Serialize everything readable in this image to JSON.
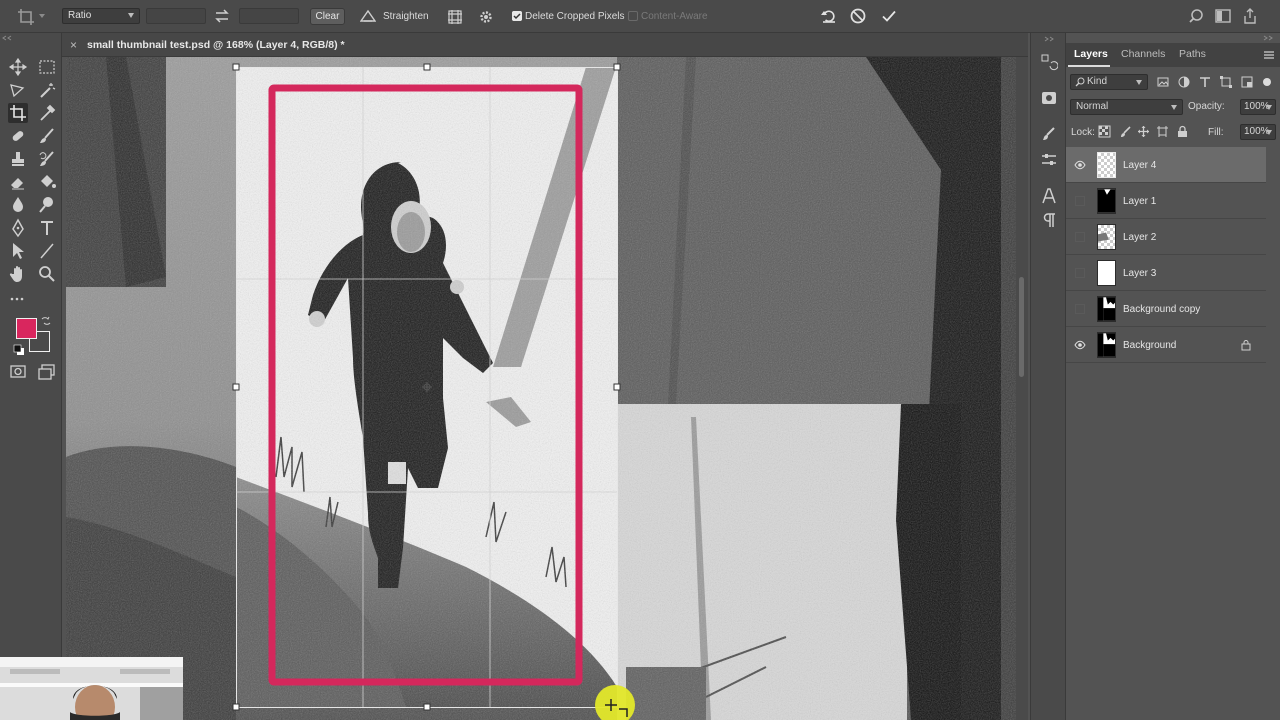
{
  "options_bar": {
    "ratio_select": "Ratio",
    "clear_label": "Clear",
    "straighten_label": "Straighten",
    "delete_cropped_label": "Delete Cropped Pixels",
    "delete_cropped_checked": true,
    "content_aware_label": "Content-Aware",
    "content_aware_checked": false
  },
  "document_tab": {
    "close_glyph": "×",
    "title": "small thumbnail test.psd @ 168% (Layer 4, RGB/8) *"
  },
  "colors": {
    "foreground": "#d9265e",
    "background": "#4a4a4a",
    "highlight_box": "#d4285c"
  },
  "layers_panel": {
    "tabs": [
      "Layers",
      "Channels",
      "Paths"
    ],
    "active_tab": "Layers",
    "kind_filter": "Kind",
    "blend_mode": "Normal",
    "opacity_label": "Opacity:",
    "opacity_value": "100%",
    "lock_label": "Lock:",
    "fill_label": "Fill:",
    "fill_value": "100%",
    "layers": [
      {
        "name": "Layer 4",
        "visible": true,
        "selected": true,
        "thumb": "transparent"
      },
      {
        "name": "Layer 1",
        "visible": false,
        "selected": false,
        "thumb": "silhouette"
      },
      {
        "name": "Layer 2",
        "visible": false,
        "selected": false,
        "thumb": "transparent-shape"
      },
      {
        "name": "Layer 3",
        "visible": false,
        "selected": false,
        "thumb": "white"
      },
      {
        "name": "Background copy",
        "visible": false,
        "selected": false,
        "thumb": "silhouette"
      },
      {
        "name": "Background",
        "visible": true,
        "selected": false,
        "thumb": "silhouette",
        "locked": true
      }
    ]
  }
}
